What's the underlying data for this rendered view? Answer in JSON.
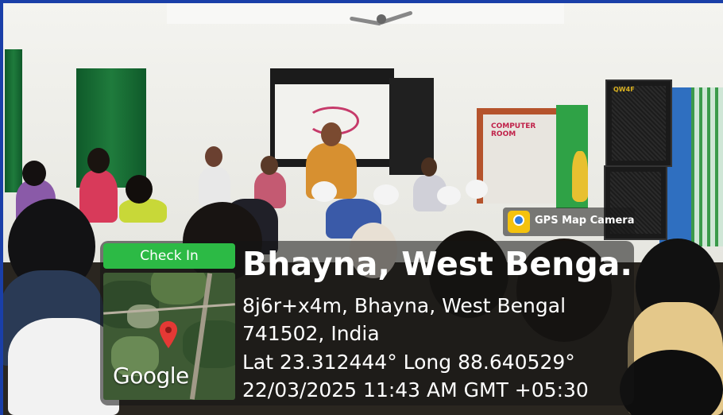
{
  "photo": {
    "subject": "seminar-hall-with-audience",
    "colors": {
      "wall": "#eeeeea",
      "curtain": "#1f7b3c",
      "door": "#b5532c",
      "accent_green": "#2cba45",
      "frame": "#1a3fa8"
    },
    "signage": {
      "door_sign": "COMPUTER ROOM",
      "speaker_logo": "QW4F"
    }
  },
  "app_tag": {
    "label": "GPS Map Camera",
    "icon": "gps-map-camera-icon"
  },
  "stamp": {
    "check_in_label": "Check In",
    "map_brand": "Google",
    "map_icon": "location-pin-icon",
    "place_title": "Bhayna, West Benga...",
    "address_line1": "8j6r+x4m, Bhayna, West Bengal",
    "address_line2": "741502, India",
    "coords": "Lat 23.312444° Long 88.640529°",
    "datetime": "22/03/2025 11:43 AM GMT +05:30"
  }
}
